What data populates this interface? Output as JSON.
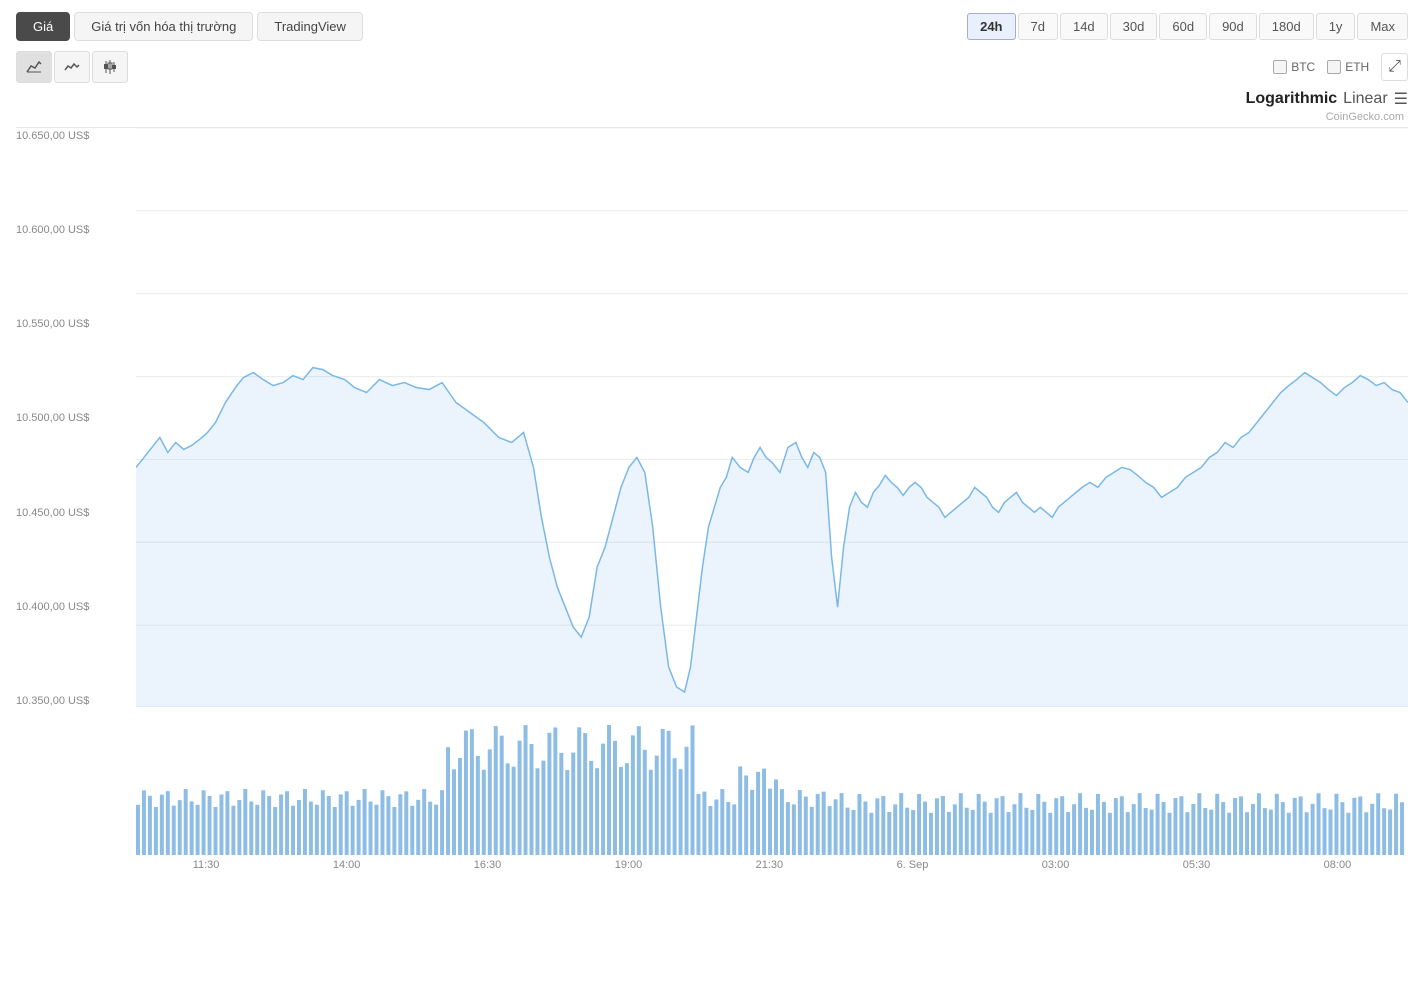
{
  "tabs": {
    "items": [
      {
        "label": "Giá",
        "active": true
      },
      {
        "label": "Giá trị vốn hóa thị trường",
        "active": false
      },
      {
        "label": "TradingView",
        "active": false
      }
    ]
  },
  "timeButtons": {
    "items": [
      {
        "label": "24h",
        "active": true
      },
      {
        "label": "7d",
        "active": false
      },
      {
        "label": "14d",
        "active": false
      },
      {
        "label": "30d",
        "active": false
      },
      {
        "label": "60d",
        "active": false
      },
      {
        "label": "90d",
        "active": false
      },
      {
        "label": "180d",
        "active": false
      },
      {
        "label": "1y",
        "active": false
      },
      {
        "label": "Max",
        "active": false
      }
    ]
  },
  "chartTypes": [
    {
      "icon": "↗",
      "active": true,
      "name": "line-area"
    },
    {
      "icon": "〰",
      "active": false,
      "name": "line"
    },
    {
      "icon": "⬛",
      "active": false,
      "name": "candlestick"
    }
  ],
  "legend": {
    "btc": {
      "label": "BTC"
    },
    "eth": {
      "label": "ETH"
    }
  },
  "scale": {
    "logarithmic": "Logarithmic",
    "linear": "Linear",
    "activeScale": "logarithmic"
  },
  "attribution": "CoinGecko.com",
  "yAxis": {
    "labels": [
      "10.650,00 US$",
      "10.600,00 US$",
      "10.550,00 US$",
      "10.500,00 US$",
      "10.450,00 US$",
      "10.400,00 US$",
      "10.350,00 US$"
    ]
  },
  "xAxis": {
    "labels": [
      "11:30",
      "14:00",
      "16:30",
      "19:00",
      "21:30",
      "6. Sep",
      "03:00",
      "05:30",
      "08:00"
    ]
  }
}
